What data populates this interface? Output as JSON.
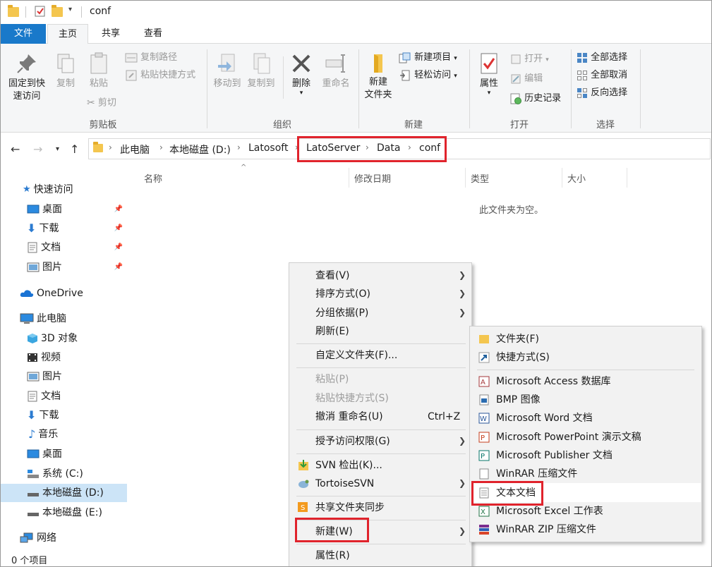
{
  "window": {
    "title": "conf"
  },
  "tabs": {
    "file": "文件",
    "home": "主页",
    "share": "共享",
    "view": "查看"
  },
  "ribbon": {
    "clipboard": {
      "label": "剪贴板",
      "pin_quick": "固定到快\n速访问",
      "copy": "复制",
      "paste": "粘贴",
      "copy_path": "复制路径",
      "paste_shortcut": "粘贴快捷方式",
      "cut": "剪切"
    },
    "organize": {
      "label": "组织",
      "move_to": "移动到",
      "copy_to": "复制到",
      "delete": "删除",
      "rename": "重命名"
    },
    "new": {
      "label": "新建",
      "new_folder": "新建\n文件夹",
      "new_item": "新建项目",
      "easy_access": "轻松访问"
    },
    "open": {
      "label": "打开",
      "properties": "属性",
      "open": "打开",
      "edit": "编辑",
      "history": "历史记录"
    },
    "select": {
      "label": "选择",
      "select_all": "全部选择",
      "select_none": "全部取消",
      "invert": "反向选择"
    }
  },
  "address": {
    "crumbs": [
      "此电脑",
      "本地磁盘 (D:)",
      "Latosoft",
      "LatoServer",
      "Data",
      "conf"
    ]
  },
  "nav": {
    "quick_access": "快速访问",
    "desktop": "桌面",
    "downloads": "下载",
    "documents": "文档",
    "pictures": "图片",
    "onedrive": "OneDrive",
    "this_pc": "此电脑",
    "objects3d": "3D 对象",
    "videos": "视频",
    "pictures2": "图片",
    "documents2": "文档",
    "downloads2": "下载",
    "music": "音乐",
    "desktop2": "桌面",
    "drive_c": "系统 (C:)",
    "drive_d": "本地磁盘 (D:)",
    "drive_e": "本地磁盘 (E:)",
    "network": "网络"
  },
  "columns": {
    "name": "名称",
    "date": "修改日期",
    "type": "类型",
    "size": "大小"
  },
  "empty_text": "此文件夹为空。",
  "status": "0 个项目",
  "context_menu": {
    "view": "查看(V)",
    "sort": "排序方式(O)",
    "group": "分组依据(P)",
    "refresh": "刷新(E)",
    "customize": "自定义文件夹(F)...",
    "paste": "粘贴(P)",
    "paste_shortcut": "粘贴快捷方式(S)",
    "undo": "撤消 重命名(U)",
    "undo_shortcut": "Ctrl+Z",
    "grant": "授予访问权限(G)",
    "svn_checkout": "SVN 检出(K)...",
    "tortoise": "TortoiseSVN",
    "share_sync": "共享文件夹同步",
    "new": "新建(W)",
    "properties": "属性(R)"
  },
  "submenu": {
    "folder": "文件夹(F)",
    "shortcut": "快捷方式(S)",
    "access": "Microsoft Access 数据库",
    "bmp": "BMP 图像",
    "word": "Microsoft Word 文档",
    "ppt": "Microsoft PowerPoint 演示文稿",
    "publisher": "Microsoft Publisher 文档",
    "winrar": "WinRAR 压缩文件",
    "text": "文本文档",
    "excel": "Microsoft Excel 工作表",
    "winrar_zip": "WinRAR ZIP 压缩文件"
  },
  "colors": {
    "accent": "#1979ca",
    "highlight": "#e0232c",
    "selected": "#cce4f7"
  }
}
